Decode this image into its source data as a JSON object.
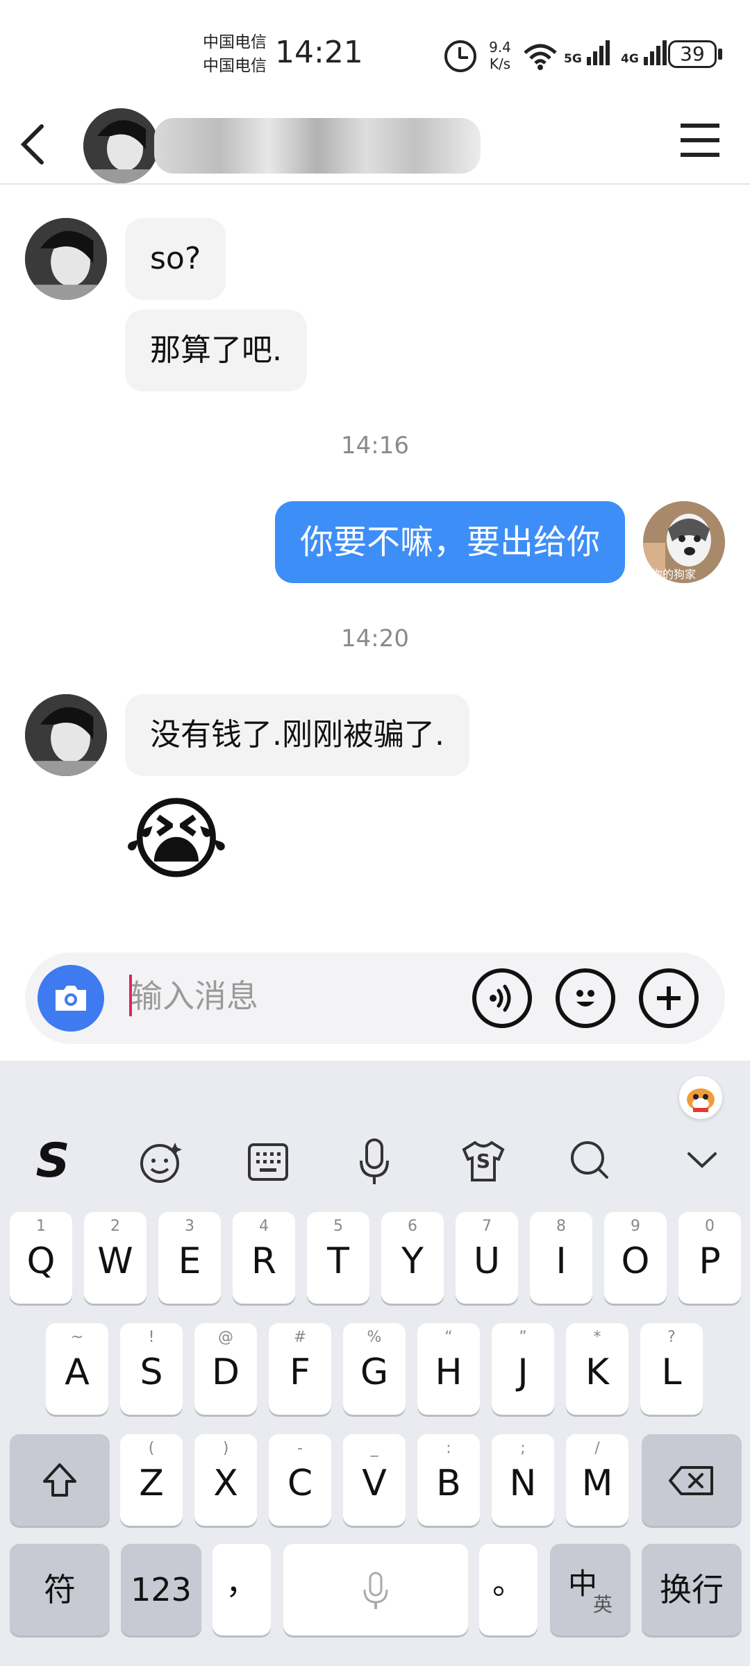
{
  "status_bar": {
    "carrier1": "中国电信",
    "carrier2": "中国电信",
    "time": "14:21",
    "speed_value": "9.4",
    "speed_unit": "K/s",
    "sig1": "5G",
    "sig2": "4G",
    "battery": "39"
  },
  "chat": {
    "messages": [
      {
        "text": "so?"
      },
      {
        "text": "那算了吧."
      },
      {
        "time": "14:16"
      },
      {
        "text": "你要不嘛，要出给你"
      },
      {
        "avatar_caption": "你的狗家"
      },
      {
        "time": "14:20"
      },
      {
        "text": "没有钱了.刚刚被骗了."
      },
      {
        "emoji": "😭"
      }
    ]
  },
  "composer": {
    "placeholder": "输入消息"
  },
  "keyboard": {
    "toolbar": {
      "logo": "S",
      "tshirt_letter": "S"
    },
    "row1": [
      {
        "hint": "1",
        "key": "Q"
      },
      {
        "hint": "2",
        "key": "W"
      },
      {
        "hint": "3",
        "key": "E"
      },
      {
        "hint": "4",
        "key": "R"
      },
      {
        "hint": "5",
        "key": "T"
      },
      {
        "hint": "6",
        "key": "Y"
      },
      {
        "hint": "7",
        "key": "U"
      },
      {
        "hint": "8",
        "key": "I"
      },
      {
        "hint": "9",
        "key": "O"
      },
      {
        "hint": "0",
        "key": "P"
      }
    ],
    "row2": [
      {
        "hint": "~",
        "key": "A"
      },
      {
        "hint": "!",
        "key": "S"
      },
      {
        "hint": "@",
        "key": "D"
      },
      {
        "hint": "#",
        "key": "F"
      },
      {
        "hint": "%",
        "key": "G"
      },
      {
        "hint": "“",
        "key": "H"
      },
      {
        "hint": "”",
        "key": "J"
      },
      {
        "hint": "*",
        "key": "K"
      },
      {
        "hint": "?",
        "key": "L"
      }
    ],
    "row3": [
      {
        "hint": "(",
        "key": "Z"
      },
      {
        "hint": ")",
        "key": "X"
      },
      {
        "hint": "-",
        "key": "C"
      },
      {
        "hint": "_",
        "key": "V"
      },
      {
        "hint": ":",
        "key": "B"
      },
      {
        "hint": ";",
        "key": "N"
      },
      {
        "hint": "/",
        "key": "M"
      }
    ],
    "bottom": {
      "symbols": "符",
      "numbers": "123",
      "comma": "，",
      "period": "。",
      "lang_main": "中",
      "lang_sub": "英",
      "enter": "换行"
    }
  }
}
